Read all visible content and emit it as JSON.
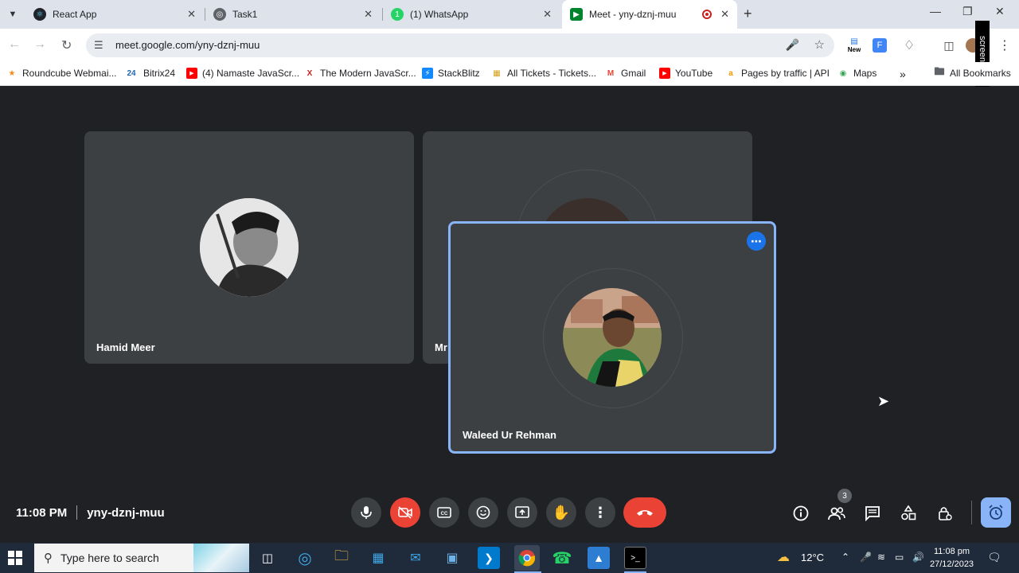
{
  "browser": {
    "tabs": [
      {
        "title": "React App",
        "icon": "react-icon"
      },
      {
        "title": "Task1",
        "icon": "globe-icon"
      },
      {
        "title": "(1) WhatsApp",
        "icon": "whatsapp-icon"
      },
      {
        "title": "Meet - yny-dznj-muu",
        "icon": "meet-icon",
        "active": true
      }
    ],
    "url": "meet.google.com/yny-dznj-muu",
    "extension_new_label": "New",
    "screenrec_label": "screenrec",
    "bookmarks": [
      {
        "label": "Roundcube Webmai...",
        "icon": "roundcube-icon"
      },
      {
        "label": "Bitrix24",
        "icon": "bitrix-icon",
        "icon_text": "24"
      },
      {
        "label": "(4) Namaste JavaScr...",
        "icon": "youtube-icon"
      },
      {
        "label": "The Modern JavaScr...",
        "icon": "person-icon"
      },
      {
        "label": "StackBlitz",
        "icon": "stackblitz-icon"
      },
      {
        "label": "All Tickets - Tickets...",
        "icon": "tickets-icon"
      },
      {
        "label": "Gmail",
        "icon": "gmail-icon"
      },
      {
        "label": "YouTube",
        "icon": "youtube-icon"
      },
      {
        "label": "Pages by traffic | API",
        "icon": "api-icon"
      },
      {
        "label": "Maps",
        "icon": "maps-icon"
      }
    ],
    "all_bookmarks_label": "All Bookmarks"
  },
  "meet": {
    "participants": [
      {
        "name": "Hamid Meer"
      },
      {
        "name": "Mr"
      },
      {
        "name": "Waleed Ur Rehman"
      }
    ],
    "time": "11:08 PM",
    "meeting_code": "yny-dznj-muu",
    "participant_count": "3",
    "colors": {
      "background": "#202124",
      "tile": "#3c4043",
      "accent": "#1a73e8",
      "danger": "#ea4335",
      "highlight": "#8ab4f8"
    }
  },
  "taskbar": {
    "search_placeholder": "Type here to search",
    "weather": "12°C",
    "clock_time": "11:08 pm",
    "clock_date": "27/12/2023"
  }
}
